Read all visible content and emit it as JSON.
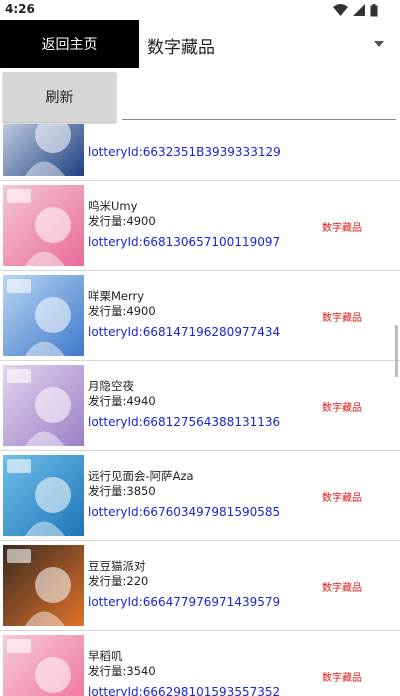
{
  "status_bar": {
    "time": "4:26"
  },
  "header": {
    "back_label": "返回主页",
    "category_value": "数字藏品"
  },
  "toolbar": {
    "refresh_label": "刷新",
    "search_value": ""
  },
  "colors": {
    "lottery_text": "#1a25d6",
    "tag_text": "#e01818",
    "back_button_bg": "#000000",
    "refresh_button_bg": "#d6d6d6"
  },
  "items": [
    {
      "title": "",
      "issue": "",
      "lottery": "lotteryId:6632351B3939333129",
      "tag": "",
      "thumb_colors": [
        "#dfe8f3",
        "#1e3f82"
      ]
    },
    {
      "title": "呜米Umy",
      "issue": "发行量:4900",
      "lottery": "lotteryId:668130657100119097",
      "tag": "数字藏品",
      "thumb_colors": [
        "#f6c6d4",
        "#e86a9a"
      ]
    },
    {
      "title": "咩栗Merry",
      "issue": "发行量:4900",
      "lottery": "lotteryId:668147196280977434",
      "tag": "数字藏品",
      "thumb_colors": [
        "#b9d6f4",
        "#3f78c9"
      ]
    },
    {
      "title": "月隐空夜",
      "issue": "发行量:4940",
      "lottery": "lotteryId:668127564388131136",
      "tag": "数字藏品",
      "thumb_colors": [
        "#e2d4ef",
        "#9b7fc4"
      ]
    },
    {
      "title": "远行见面会-阿萨Aza",
      "issue": "发行量:3850",
      "lottery": "lotteryId:667603497981590585",
      "tag": "数字藏品",
      "thumb_colors": [
        "#6fc0ea",
        "#1f74b8"
      ]
    },
    {
      "title": "豆豆猫派对",
      "issue": "发行量:220",
      "lottery": "lotteryId:666477976971439579",
      "tag": "数字藏品",
      "thumb_colors": [
        "#3a2a20",
        "#e0722a"
      ]
    },
    {
      "title": "早稻叽",
      "issue": "发行量:3540",
      "lottery": "lotteryId:666298101593557352",
      "tag": "数字藏品",
      "thumb_colors": [
        "#f7c9d8",
        "#ee6f95"
      ]
    }
  ]
}
